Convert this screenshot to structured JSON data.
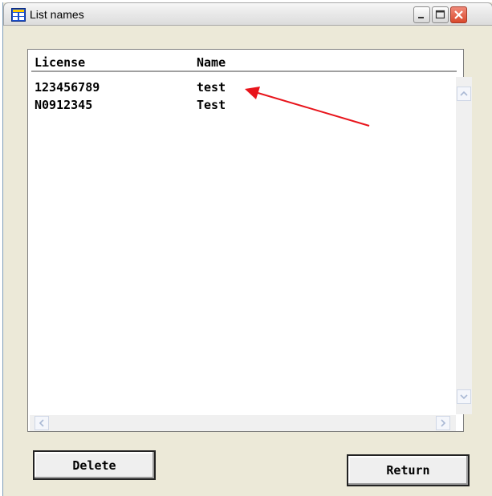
{
  "window": {
    "title": "List names",
    "icon": "app-icon"
  },
  "list": {
    "columns": [
      "License",
      "Name"
    ],
    "rows": [
      {
        "license": "123456789",
        "name": "test"
      },
      {
        "license": "N0912345",
        "name": "Test"
      }
    ]
  },
  "buttons": {
    "delete_label": "Delete",
    "return_label": "Return"
  },
  "annotation": {
    "type": "arrow",
    "color": "#e8141b",
    "points_to": "list.rows.0.name"
  }
}
